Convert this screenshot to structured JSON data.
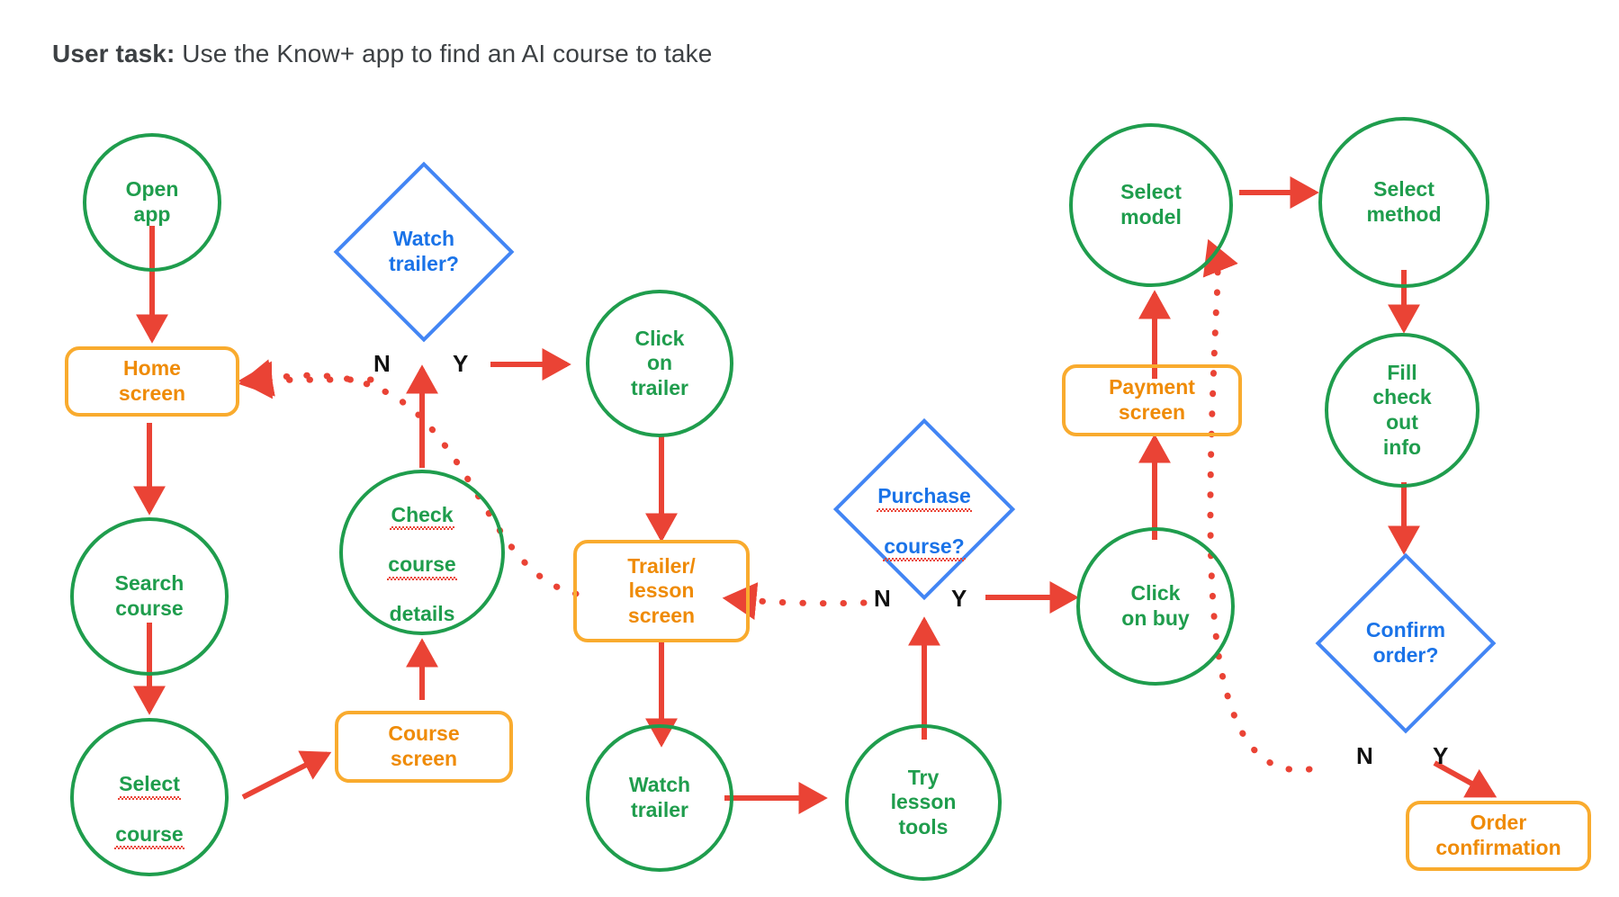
{
  "title": {
    "prefix": "User task:",
    "text": " Use the Know+ app to find an AI course to take"
  },
  "colors": {
    "process_green": "#1f9d4d",
    "screen_orange": "#ef8b06",
    "screen_orange_border": "#f9ab2e",
    "decision_blue": "#1a73e8",
    "decision_blue_border": "#4285f4",
    "arrow_red": "#ea4335",
    "title_gray": "#3c4043",
    "branch_black": "#111111"
  },
  "nodes": {
    "open_app": {
      "label": "Open\napp",
      "shape": "circle"
    },
    "home_screen": {
      "label": "Home\nscreen",
      "shape": "rounded"
    },
    "search_course": {
      "label": "Search\ncourse",
      "shape": "circle"
    },
    "select_course": {
      "line1": "Select",
      "line2": "course",
      "shape": "circle"
    },
    "course_screen": {
      "label": "Course\nscreen",
      "shape": "rounded"
    },
    "check_course_details": {
      "line1": "Check",
      "line2": "course",
      "line3": "details",
      "shape": "circle"
    },
    "watch_trailer_q": {
      "label": "Watch\ntrailer?",
      "shape": "diamond"
    },
    "click_on_trailer": {
      "label": "Click\non\ntrailer",
      "shape": "circle"
    },
    "trailer_lesson_screen": {
      "label": "Trailer/\nlesson\nscreen",
      "shape": "rounded"
    },
    "watch_trailer": {
      "label": "Watch\ntrailer",
      "shape": "circle"
    },
    "try_lesson_tools": {
      "label": "Try\nlesson\ntools",
      "shape": "circle"
    },
    "purchase_course_q": {
      "line1": "Purchase",
      "line2": "course?",
      "shape": "diamond"
    },
    "click_on_buy": {
      "label": "Click\non buy",
      "shape": "circle"
    },
    "payment_screen": {
      "label": "Payment\nscreen",
      "shape": "rounded"
    },
    "select_model": {
      "label": "Select\nmodel",
      "shape": "circle"
    },
    "select_method": {
      "label": "Select\nmethod",
      "shape": "circle"
    },
    "fill_check_out_info": {
      "label": "Fill\ncheck\nout\ninfo",
      "shape": "circle"
    },
    "confirm_order_q": {
      "label": "Confirm\norder?",
      "shape": "diamond"
    },
    "order_confirmation": {
      "label": "Order\nconfirmation",
      "shape": "rounded"
    }
  },
  "branches": {
    "watch_trailer_n": "N",
    "watch_trailer_y": "Y",
    "purchase_course_n": "N",
    "purchase_course_y": "Y",
    "confirm_order_n": "N",
    "confirm_order_y": "Y"
  }
}
